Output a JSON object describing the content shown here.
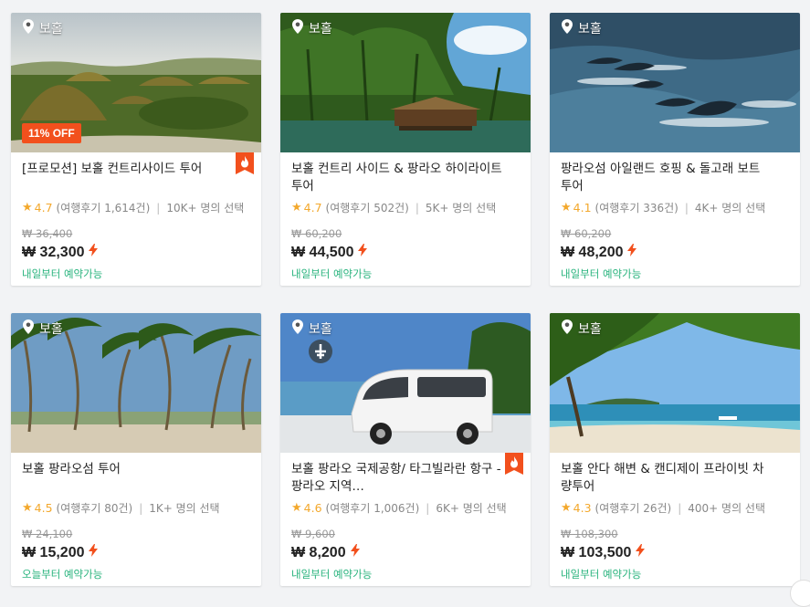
{
  "cards": [
    {
      "location": "보홀",
      "badge": "11% OFF",
      "title": "[프로모션] 보홀 컨트리사이드 투어",
      "rating": "4.7",
      "reviews": "(여행후기 1,614건)",
      "chosen": "10K+ 명의 선택",
      "original_price": "₩ 36,400",
      "price": "₩ 32,300",
      "availability": "내일부터 예약가능",
      "hot": true,
      "image": "chocolate-hills"
    },
    {
      "location": "보홀",
      "badge": "",
      "title": "보홀 컨트리 사이드 & 팡라오 하이라이트 투어",
      "rating": "4.7",
      "reviews": "(여행후기 502건)",
      "chosen": "5K+ 명의 선택",
      "original_price": "₩ 60,200",
      "price": "₩ 44,500",
      "availability": "내일부터 예약가능",
      "hot": false,
      "image": "river-cruise"
    },
    {
      "location": "보홀",
      "badge": "",
      "title": "팡라오섬 아일랜드 호핑 & 돌고래 보트 투어",
      "rating": "4.1",
      "reviews": "(여행후기 336건)",
      "chosen": "4K+ 명의 선택",
      "original_price": "₩ 60,200",
      "price": "₩ 48,200",
      "availability": "내일부터 예약가능",
      "hot": false,
      "image": "dolphins"
    },
    {
      "location": "보홀",
      "badge": "",
      "title": "보홀 팡라오섬 투어",
      "rating": "4.5",
      "reviews": "(여행후기 80건)",
      "chosen": "1K+ 명의 선택",
      "original_price": "₩ 24,100",
      "price": "₩ 15,200",
      "availability": "오늘부터 예약가능",
      "hot": false,
      "image": "palm-beach"
    },
    {
      "location": "보홀",
      "badge": "",
      "title": "보홀 팡라오 국제공항/ 타그빌라란 항구 - 팡라오 지역…",
      "rating": "4.6",
      "reviews": "(여행후기 1,006건)",
      "chosen": "6K+ 명의 선택",
      "original_price": "₩ 9,600",
      "price": "₩ 8,200",
      "availability": "내일부터 예약가능",
      "hot": true,
      "image": "van"
    },
    {
      "location": "보홀",
      "badge": "",
      "title": "보홀 안다 해변 & 캔디제이 프라이빗 차량투어",
      "rating": "4.3",
      "reviews": "(여행후기 26건)",
      "chosen": "400+ 명의 선택",
      "original_price": "₩ 108,300",
      "price": "₩ 103,500",
      "availability": "내일부터 예약가능",
      "hot": false,
      "image": "beach"
    }
  ],
  "colors": {
    "accent": "#f2501d",
    "star": "#f3a82c",
    "available": "#28b37d"
  },
  "icons": {
    "location": "location-pin-icon",
    "hot": "fire-badge-icon",
    "bolt": "lightning-icon",
    "star": "star-icon",
    "airport": "airplane-icon"
  }
}
